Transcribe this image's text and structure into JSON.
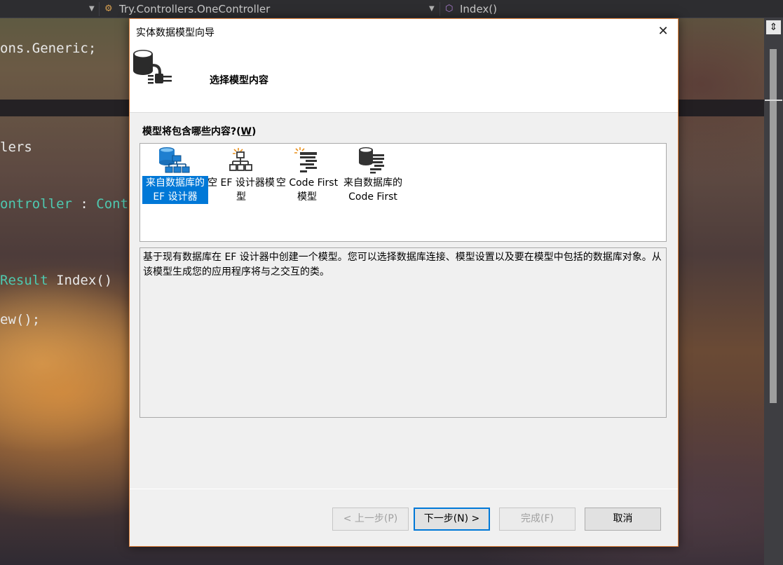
{
  "ide": {
    "controller_combo": "Try.Controllers.OneController",
    "method_combo": "Index()",
    "code_lines": [
      {
        "text": "ons.Generic;",
        "green": false
      },
      {
        "text": "lers",
        "green": false
      },
      {
        "text_green": "ontroller",
        "text_rest": " : ",
        "text_tail": "Contr"
      },
      {
        "text_green": "Result",
        "text_rest": " Index()"
      },
      {
        "text": "ew();",
        "green": false
      }
    ]
  },
  "dialog": {
    "title": "实体数据模型向导",
    "close_symbol": "✕",
    "subtitle": "选择模型内容",
    "section_prefix": "模型将包含哪些内容?(",
    "section_key": "W",
    "section_suffix": ")",
    "choices": [
      {
        "label": "来自数据库的 EF 设计器",
        "selected": true,
        "icon": "database-designer-icon"
      },
      {
        "label": "空 EF 设计器模型",
        "selected": false,
        "icon": "empty-designer-icon"
      },
      {
        "label": "空 Code First 模型",
        "selected": false,
        "icon": "empty-code-first-icon"
      },
      {
        "label": "来自数据库的 Code First",
        "selected": false,
        "icon": "database-code-first-icon"
      }
    ],
    "description": "基于现有数据库在 EF 设计器中创建一个模型。您可以选择数据库连接、模型设置以及要在模型中包括的数据库对象。从该模型生成您的应用程序将与之交互的类。",
    "buttons": {
      "prev": "< 上一步(P)",
      "next": "下一步(N) >",
      "finish": "完成(F)",
      "cancel": "取消"
    },
    "accent": "#0078d7"
  }
}
